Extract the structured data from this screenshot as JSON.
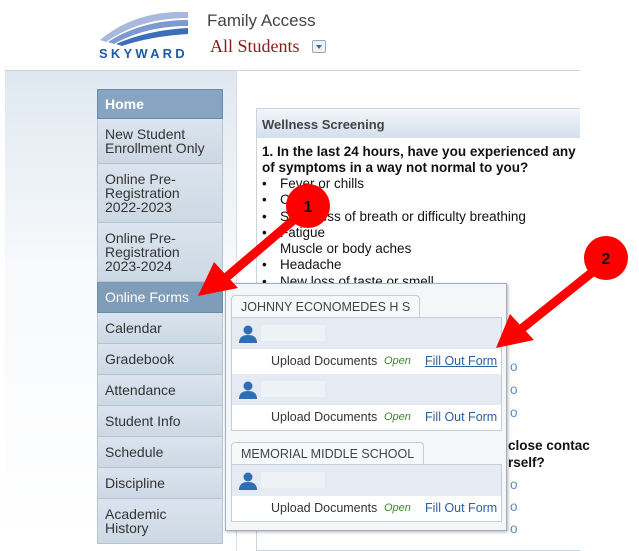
{
  "header": {
    "logo_text": "SKYWARD",
    "app_title": "Family Access",
    "student_selector": "All Students"
  },
  "nav": {
    "items": [
      "Home",
      "New Student Enrollment Only",
      "Online Pre-Registration 2022-2023",
      "Online Pre-Registration 2023-2024",
      "Online Forms",
      "Calendar",
      "Gradebook",
      "Attendance",
      "Student Info",
      "Schedule",
      "Discipline",
      "Academic History"
    ],
    "active": "Online Forms"
  },
  "panel": {
    "title": "Wellness Screening",
    "question1": "1. In the last 24 hours, have you experienced any of symptoms in a way not normal to you?",
    "symptoms": [
      "Fever or chills",
      "Cough",
      "Shortness of breath or difficulty breathing",
      "Fatigue",
      "Muscle or body aches",
      "Headache",
      "New loss of taste or smell"
    ],
    "fragment_close": "close contac",
    "fragment_yourself": "rself?",
    "no_label": "o"
  },
  "popup": {
    "schools": [
      {
        "name": "JOHNNY ECONOMEDES H S",
        "students": [
          {
            "upload": "Upload Documents",
            "status": "Open",
            "fill": "Fill Out Form"
          },
          {
            "upload": "Upload Documents",
            "status": "Open",
            "fill": "Fill Out Form"
          }
        ]
      },
      {
        "name": "MEMORIAL MIDDLE SCHOOL",
        "students": [
          {
            "upload": "Upload Documents",
            "status": "Open",
            "fill": "Fill Out Form"
          }
        ]
      }
    ]
  },
  "annotations": {
    "step1": "1",
    "step2": "2",
    "color": "#ff0000"
  }
}
